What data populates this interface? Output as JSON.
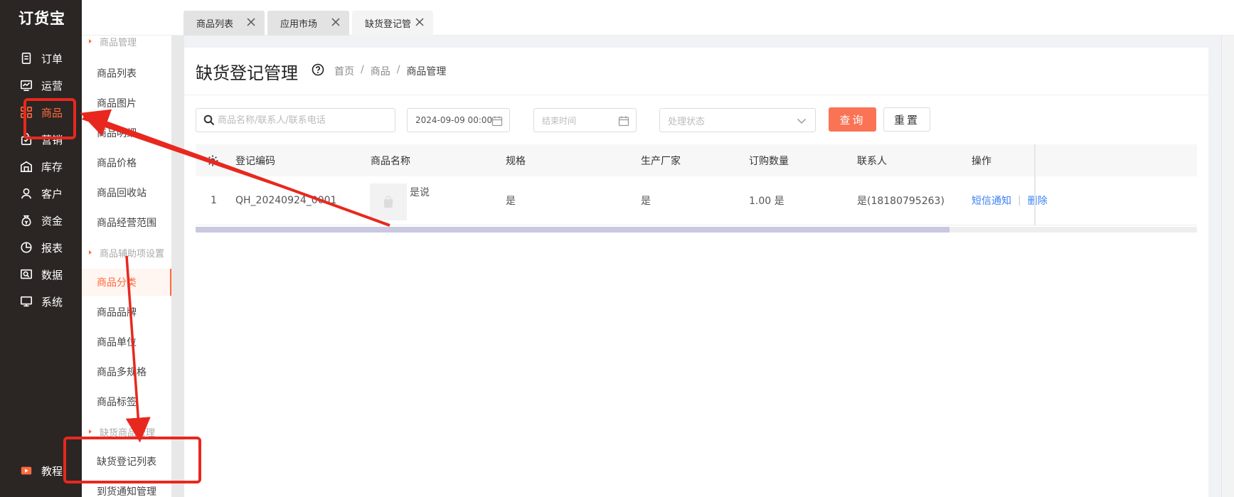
{
  "app": {
    "logo": "订货宝"
  },
  "nav": {
    "items": [
      {
        "label": "订单",
        "icon": "order-icon"
      },
      {
        "label": "运营",
        "icon": "chart-line-icon"
      },
      {
        "label": "商品",
        "icon": "grid-icon",
        "active": true
      },
      {
        "label": "营销",
        "icon": "bag-icon"
      },
      {
        "label": "库存",
        "icon": "warehouse-icon"
      },
      {
        "label": "客户",
        "icon": "user-icon"
      },
      {
        "label": "资金",
        "icon": "money-bag-icon"
      },
      {
        "label": "报表",
        "icon": "pie-icon"
      },
      {
        "label": "数据",
        "icon": "data-icon"
      },
      {
        "label": "系统",
        "icon": "monitor-icon"
      }
    ],
    "bottom": {
      "label": "教程",
      "icon": "video-icon"
    }
  },
  "submenu": {
    "group1": "商品管理",
    "items1": [
      "商品列表",
      "商品图片",
      "商品明细",
      "商品价格",
      "商品回收站",
      "商品经营范围"
    ],
    "group2": "商品辅助项设置",
    "items2": [
      "商品分类",
      "商品品牌",
      "商品单位",
      "商品多规格",
      "商品标签"
    ],
    "group3": "缺货商品管理",
    "items3": [
      "缺货登记列表",
      "到货通知管理"
    ]
  },
  "tabs": [
    {
      "label": "商品列表"
    },
    {
      "label": "应用市场"
    },
    {
      "label": "缺货登记管理",
      "active": true
    }
  ],
  "page": {
    "title": "缺货登记管理",
    "breadcrumb": [
      "首页",
      "商品",
      "商品管理"
    ]
  },
  "filters": {
    "search_placeholder": "商品名称/联系人/联系电话",
    "start_date": "2024-09-09 00:00",
    "end_placeholder": "结束时间",
    "status_placeholder": "处理状态",
    "query_label": "查询",
    "reset_label": "重置"
  },
  "table": {
    "headers": [
      "登记编码",
      "商品名称",
      "规格",
      "生产厂家",
      "订购数量",
      "联系人",
      "操作"
    ],
    "rows": [
      {
        "index": "1",
        "code": "QH_20240924_0001",
        "product": "是说",
        "spec": "是",
        "maker": "是",
        "qty": "1.00 是",
        "contact": "是(18180795263)",
        "ops": [
          "短信通知",
          "删除"
        ]
      }
    ]
  },
  "colors": {
    "accent": "#ff6a3d",
    "annotation": "#e8281e",
    "link": "#3b82f6"
  }
}
